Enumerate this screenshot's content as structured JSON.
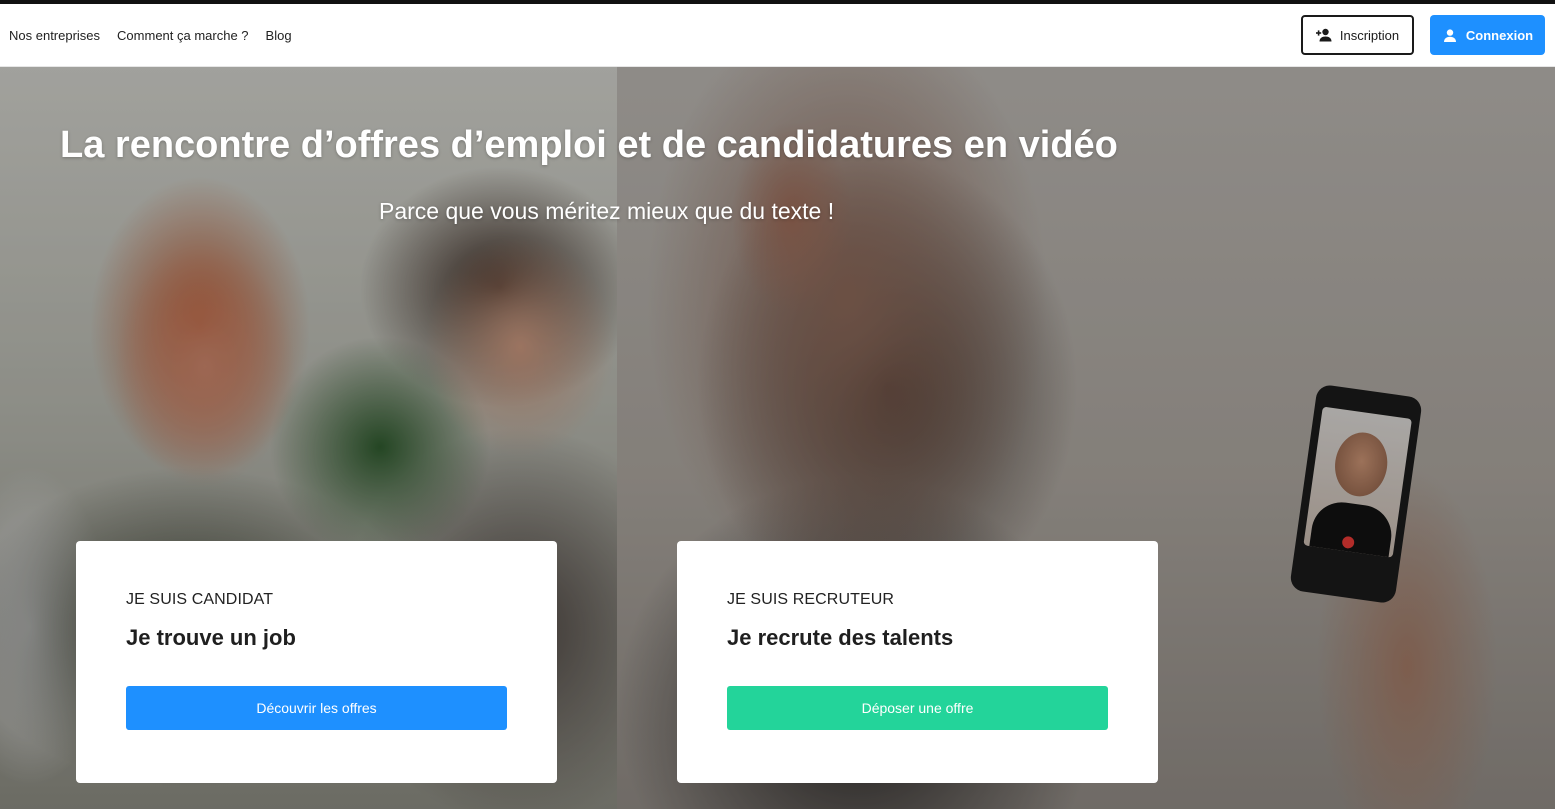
{
  "navbar": {
    "links": [
      "Nos entreprises",
      "Comment ça marche ?",
      "Blog"
    ],
    "signup_label": "Inscription",
    "signup_icon": "person-add-icon",
    "login_label": "Connexion",
    "login_icon": "person-icon"
  },
  "hero": {
    "title": "La rencontre d’offres d’emploi et de candidatures en vidéo",
    "subtitle": "Parce que vous méritez mieux que du texte !"
  },
  "cards": {
    "candidate": {
      "kicker": "JE SUIS CANDIDAT",
      "heading": "Je trouve un job",
      "button": "Découvrir les offres",
      "button_color": "#1e90ff"
    },
    "recruiter": {
      "kicker": "JE SUIS RECRUTEUR",
      "heading": "Je recrute des talents",
      "button": "Déposer une offre",
      "button_color": "#23d49a"
    }
  },
  "colors": {
    "primary": "#1e90ff",
    "accent": "#23d49a"
  }
}
